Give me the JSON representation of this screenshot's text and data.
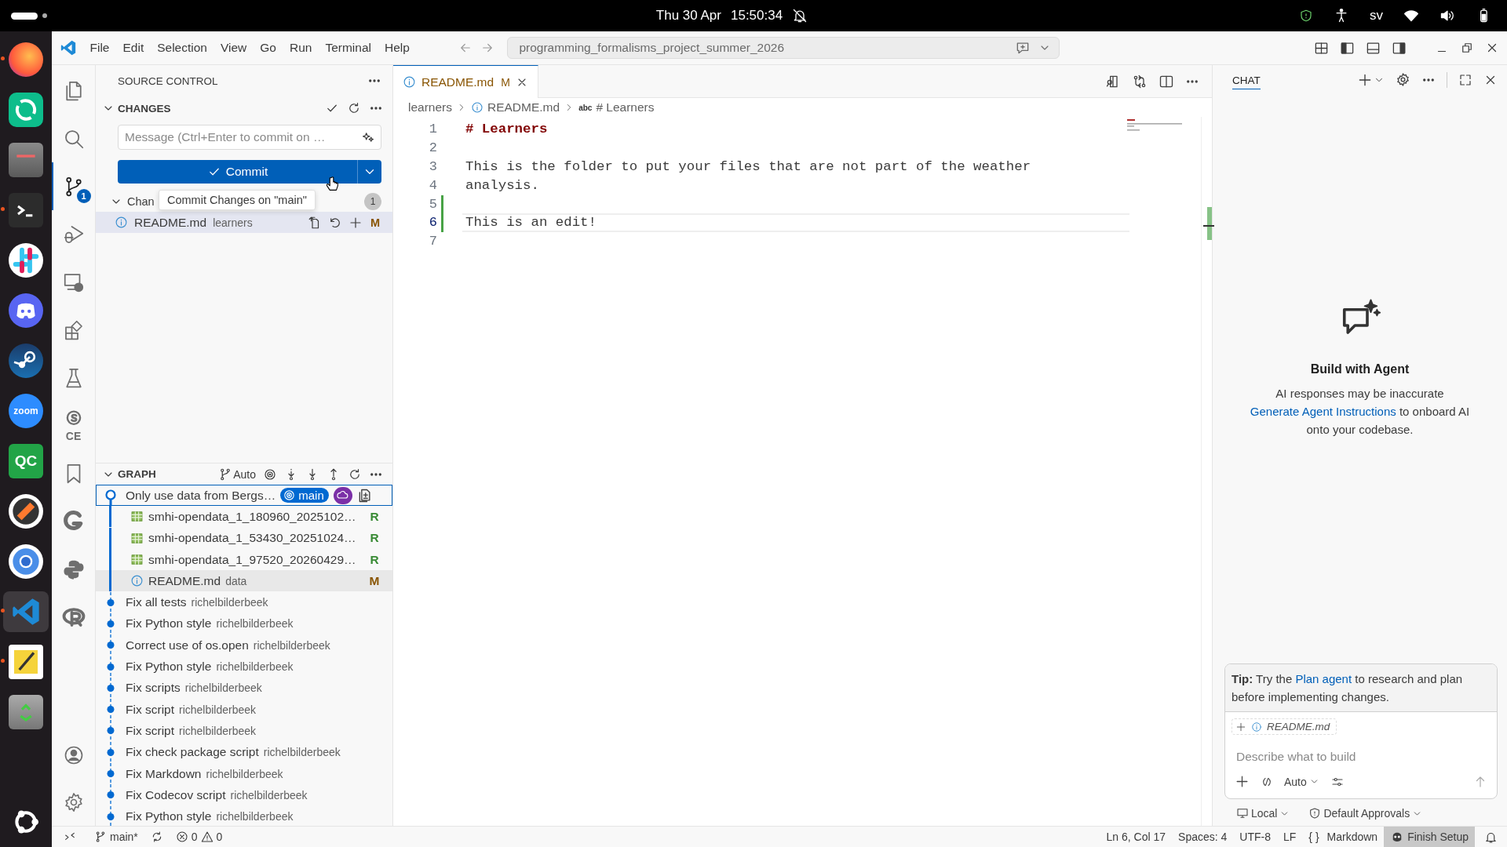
{
  "top_bar": {
    "date": "Thu 30 Apr",
    "time": "15:50:34",
    "keyboard_layout": "sv"
  },
  "dock": [
    {
      "kind": "firefox",
      "running": true,
      "selected": false
    },
    {
      "kind": "element",
      "running": false,
      "selected": false
    },
    {
      "kind": "files",
      "running": false,
      "selected": false
    },
    {
      "kind": "terminal",
      "running": true,
      "selected": false
    },
    {
      "kind": "slack",
      "running": false,
      "selected": false
    },
    {
      "kind": "discord",
      "running": false,
      "selected": false
    },
    {
      "kind": "steam",
      "running": false,
      "selected": false
    },
    {
      "kind": "zoom",
      "label": "zoom",
      "running": false,
      "selected": false
    },
    {
      "kind": "qc",
      "label": "QC",
      "running": false,
      "selected": false
    },
    {
      "kind": "merge",
      "running": false,
      "selected": false
    },
    {
      "kind": "chromium",
      "running": false,
      "selected": false
    },
    {
      "kind": "vscode",
      "running": true,
      "selected": true
    },
    {
      "kind": "text-editor",
      "running": true,
      "selected": false
    },
    {
      "kind": "trash",
      "running": false,
      "selected": false
    },
    {
      "kind": "ubuntu",
      "running": false,
      "selected": false
    }
  ],
  "title_bar": {
    "menu": [
      "File",
      "Edit",
      "Selection",
      "View",
      "Go",
      "Run",
      "Terminal",
      "Help"
    ],
    "command_center": "programming_formalisms_project_summer_2026"
  },
  "activity_bar": {
    "items": [
      {
        "kind": "explorer",
        "selected": false
      },
      {
        "kind": "search",
        "selected": false
      },
      {
        "kind": "source-control",
        "selected": true,
        "badge": "1"
      },
      {
        "kind": "run-debug",
        "selected": false
      },
      {
        "kind": "remote",
        "selected": false
      },
      {
        "kind": "extensions",
        "selected": false
      },
      {
        "kind": "testing",
        "selected": false
      },
      {
        "kind": "sonar",
        "label": "CE",
        "selected": false
      },
      {
        "kind": "bookmarks",
        "selected": false
      },
      {
        "kind": "gitlens",
        "selected": false
      },
      {
        "kind": "python",
        "selected": false
      },
      {
        "kind": "r",
        "selected": false
      }
    ],
    "bottom": [
      {
        "kind": "accounts"
      },
      {
        "kind": "settings"
      }
    ]
  },
  "source_control": {
    "title": "SOURCE CONTROL",
    "changes": {
      "title": "CHANGES",
      "expanded": true,
      "message_placeholder": "Message (Ctrl+Enter to commit on …",
      "commit_label": "Commit",
      "tooltip": "Commit Changes on \"main\"",
      "group": {
        "label": "Chan",
        "count": "1",
        "expanded": true,
        "files": [
          {
            "name": "README.md",
            "folder": "learners",
            "status": "M",
            "selected": true
          }
        ]
      }
    }
  },
  "graph": {
    "title": "GRAPH",
    "expanded": true,
    "mode": "Auto",
    "commits": [
      {
        "message": "Only use data from Bergs…",
        "branch": "main",
        "selected": true,
        "expanded": true,
        "files": [
          {
            "kind": "csv",
            "name": "smhi-opendata_1_180960_2025102…",
            "status": "R",
            "selected": false
          },
          {
            "kind": "csv",
            "name": "smhi-opendata_1_53430_20251024…",
            "status": "R",
            "selected": false
          },
          {
            "kind": "csv",
            "name": "smhi-opendata_1_97520_20260429…",
            "status": "R",
            "selected": false
          },
          {
            "kind": "markdown",
            "name": "README.md",
            "folder": "data",
            "status": "M",
            "selected": true
          }
        ]
      },
      {
        "message": "Fix all tests",
        "author": "richelbilderbeek",
        "selected": false
      },
      {
        "message": "Fix Python style",
        "author": "richelbilderbeek",
        "selected": false
      },
      {
        "message": "Correct use of os.open",
        "author": "richelbilderbeek",
        "selected": false
      },
      {
        "message": "Fix Python style",
        "author": "richelbilderbeek",
        "selected": false
      },
      {
        "message": "Fix scripts",
        "author": "richelbilderbeek",
        "selected": false
      },
      {
        "message": "Fix script",
        "author": "richelbilderbeek",
        "selected": false
      },
      {
        "message": "Fix script",
        "author": "richelbilderbeek",
        "selected": false
      },
      {
        "message": "Fix check package script",
        "author": "richelbilderbeek",
        "selected": false
      },
      {
        "message": "Fix Markdown",
        "author": "richelbilderbeek",
        "selected": false
      },
      {
        "message": "Fix Codecov script",
        "author": "richelbilderbeek",
        "selected": false
      },
      {
        "message": "Fix Python style",
        "author": "richelbilderbeek",
        "selected": false
      }
    ]
  },
  "editor": {
    "tabs": [
      {
        "label": "README.md",
        "status": "M",
        "selected": true
      }
    ],
    "breadcrumbs": [
      {
        "kind": "folder",
        "label": "learners"
      },
      {
        "kind": "file",
        "label": "README.md"
      },
      {
        "kind": "symbol",
        "icon": "abc",
        "label": "# Learners"
      }
    ],
    "lines": [
      {
        "number": "1",
        "kind": "heading",
        "text": "# Learners",
        "added": false,
        "current": false
      },
      {
        "number": "2",
        "added": false,
        "current": false
      },
      {
        "number": "3",
        "kind": "text",
        "text": "This is the folder to put your files that are not part of the weather",
        "added": false,
        "current": false
      },
      {
        "number": "4",
        "kind": "text",
        "text": "analysis.",
        "added": false,
        "current": false
      },
      {
        "number": "5",
        "added": true,
        "current": false
      },
      {
        "number": "6",
        "kind": "text",
        "text": "This is an edit!",
        "added": true,
        "current": true
      },
      {
        "number": "7",
        "added": false,
        "current": false
      }
    ]
  },
  "chat": {
    "title": "CHAT",
    "heading": "Build with Agent",
    "disclaimer": "AI responses may be inaccurate",
    "link": "Generate Agent Instructions",
    "link_after": "to onboard AI onto your codebase.",
    "tip": {
      "lead": "**Tip:** Try the",
      "link": "Plan agent",
      "after": "to research and plan before implementing changes."
    },
    "attachment": "README.md",
    "placeholder": "Describe what to build",
    "mode": "Auto",
    "location": "Local",
    "approvals": "Default Approvals"
  },
  "status_bar": {
    "branch": "main*",
    "errors": "0",
    "warnings": "0",
    "items": [
      "Ln 6, Col 17",
      "Spaces: 4",
      "UTF-8",
      "LF"
    ],
    "language_icon": "{ }",
    "language": "Markdown",
    "setup": "Finish Setup"
  }
}
